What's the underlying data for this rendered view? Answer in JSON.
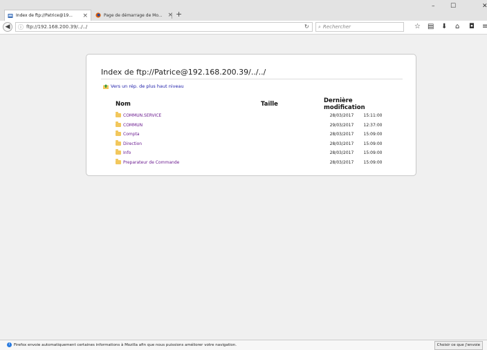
{
  "browser": {
    "tabs": [
      {
        "title": "Index de ftp://Patrice@19...",
        "close": "×"
      },
      {
        "title": "Page de démarrage de Mo...",
        "close": "×"
      }
    ],
    "new_tab": "+",
    "window_controls": {
      "minimize": "–",
      "maximize": "☐",
      "close": "✕"
    },
    "url": "ftp://192.168.200.39/../../",
    "search_placeholder": "Rechercher",
    "colors": {
      "link": "#1a1aa8",
      "visited": "#6a1a8f",
      "folder": "#f2c75c"
    }
  },
  "page": {
    "heading": "Index de ftp://Patrice@192.168.200.39/../../",
    "up_link": "Vers un rép. de plus haut niveau",
    "columns": {
      "name": "Nom",
      "size": "Taille",
      "modified": "Dernière modification"
    },
    "rows": [
      {
        "name": "COMMUN.SERVICE",
        "size": "",
        "date": "28/03/2017",
        "time": "15:11:00"
      },
      {
        "name": "COMMUN",
        "size": "",
        "date": "29/03/2017",
        "time": "12:37:00"
      },
      {
        "name": "Compta",
        "size": "",
        "date": "28/03/2017",
        "time": "15:09:00"
      },
      {
        "name": "Direction",
        "size": "",
        "date": "28/03/2017",
        "time": "15:09:00"
      },
      {
        "name": "Info",
        "size": "",
        "date": "28/03/2017",
        "time": "15:09:00"
      },
      {
        "name": "Preparateur de Commande",
        "size": "",
        "date": "28/03/2017",
        "time": "15:09:00"
      }
    ]
  },
  "notification": {
    "message": "Firefox envoie automatiquement certaines informations à Mozilla afin que nous puissions améliorer votre navigation.",
    "button": "Choisir ce que j'envoie"
  }
}
